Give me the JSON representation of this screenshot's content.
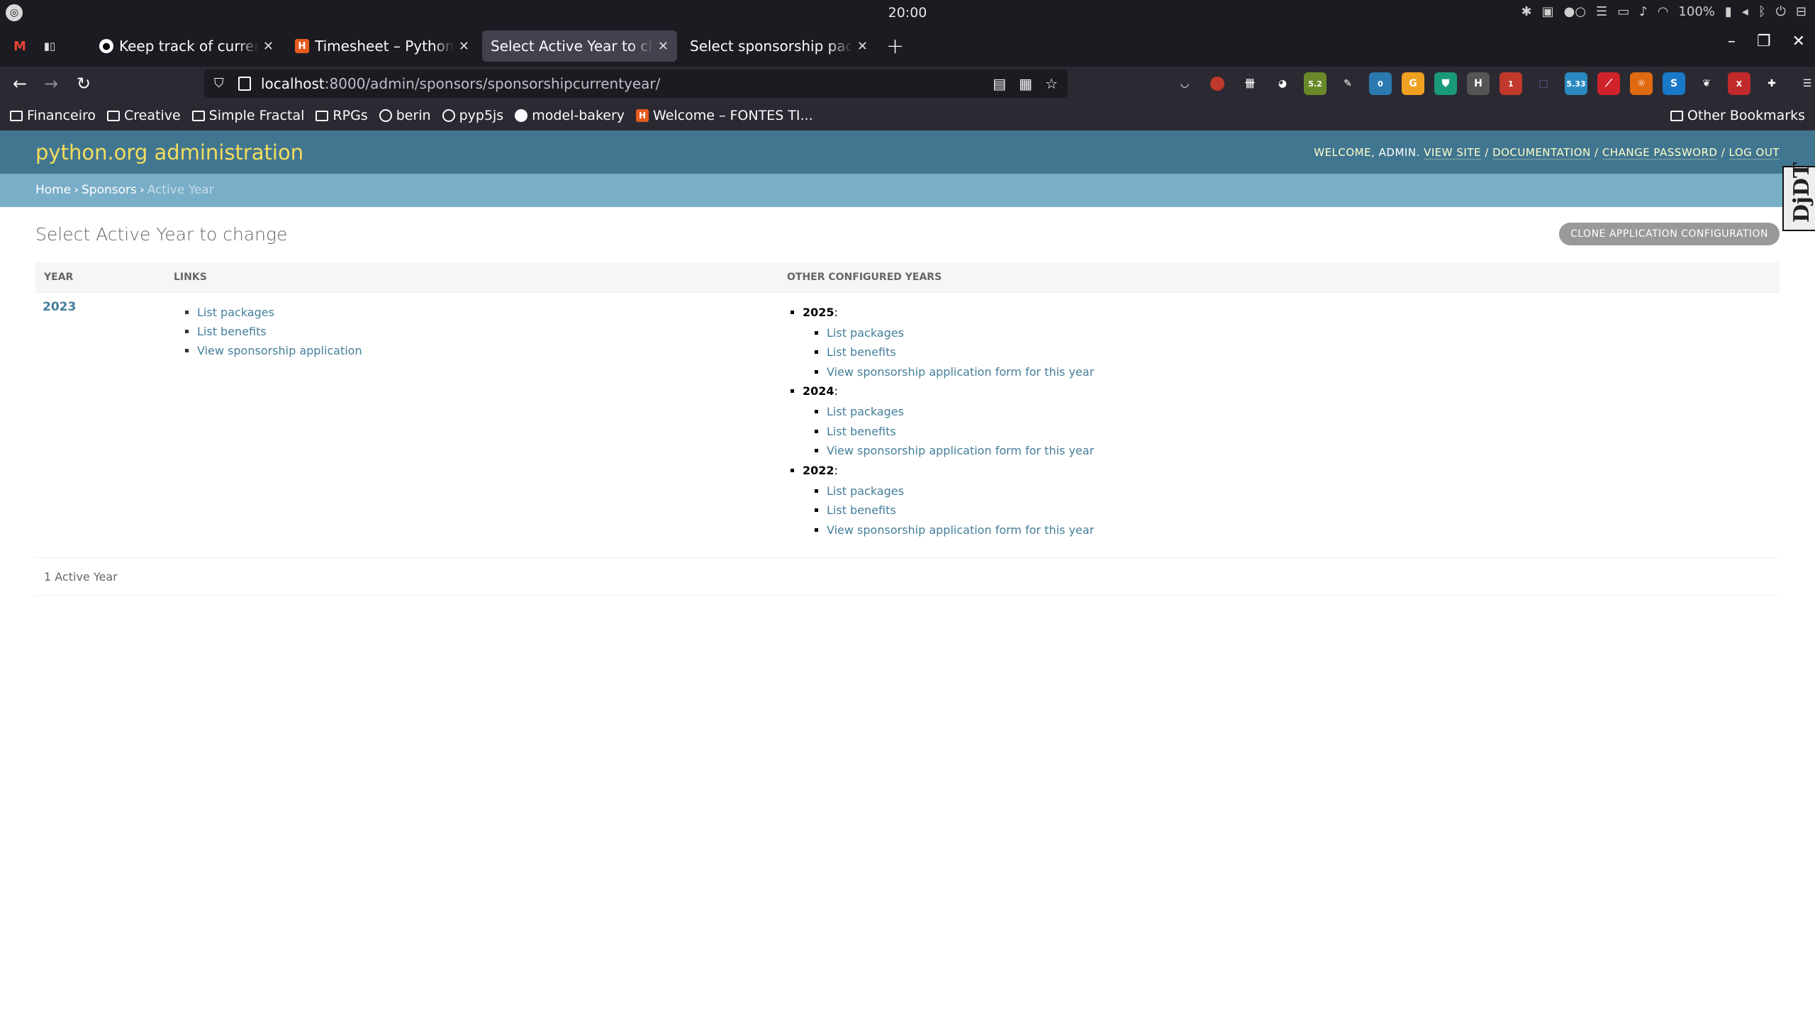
{
  "os": {
    "clock": "20:00",
    "battery": "100%"
  },
  "browser": {
    "tabs": [
      {
        "title": "Keep track of current sp",
        "favicon": "github-icon",
        "active": false
      },
      {
        "title": "Timesheet – Python Soft",
        "favicon": "harvest-icon",
        "active": false
      },
      {
        "title": "Select Active Year to change",
        "favicon": "",
        "active": true
      },
      {
        "title": "Select sponsorship package",
        "favicon": "",
        "active": false
      }
    ],
    "url_host": "localhost",
    "url_rest": ":8000/admin/sponsors/sponsorshipcurrentyear/",
    "extension_badges": {
      "a": "5.2",
      "b": "0",
      "c": "1",
      "d": "5.33",
      "e": "X"
    },
    "bookmarks": [
      {
        "label": "Financeiro",
        "icon": "folder-icon"
      },
      {
        "label": "Creative",
        "icon": "folder-icon"
      },
      {
        "label": "Simple Fractal",
        "icon": "folder-icon"
      },
      {
        "label": "RPGs",
        "icon": "folder-icon"
      },
      {
        "label": "berin",
        "icon": "globe-icon"
      },
      {
        "label": "pyp5js",
        "icon": "globe-icon"
      },
      {
        "label": "model-bakery",
        "icon": "github-icon"
      },
      {
        "label": "Welcome – FONTES TI...",
        "icon": "harvest-icon"
      }
    ],
    "other_bookmarks": "Other Bookmarks"
  },
  "admin": {
    "branding": "python.org administration",
    "welcome": "Welcome,",
    "username": "admin",
    "view_site": "View site",
    "documentation": "Documentation",
    "change_password": "Change password",
    "log_out": "Log out",
    "breadcrumbs": {
      "home": "Home",
      "sponsors": "Sponsors",
      "current": "Active Year"
    },
    "djdt": "DjDT"
  },
  "content": {
    "title": "Select Active Year to change",
    "clone_button": "Clone application configuration",
    "columns": {
      "year": "Year",
      "links": "Links",
      "other": "Other configured years"
    },
    "row": {
      "year": "2023",
      "links": [
        "List packages",
        "List benefits",
        "View sponsorship application"
      ],
      "other_years": [
        {
          "year": "2025",
          "links": [
            "List packages",
            "List benefits",
            "View sponsorship application form for this year"
          ]
        },
        {
          "year": "2024",
          "links": [
            "List packages",
            "List benefits",
            "View sponsorship application form for this year"
          ]
        },
        {
          "year": "2022",
          "links": [
            "List packages",
            "List benefits",
            "View sponsorship application form for this year"
          ]
        }
      ]
    },
    "paginator": "1 Active Year"
  }
}
